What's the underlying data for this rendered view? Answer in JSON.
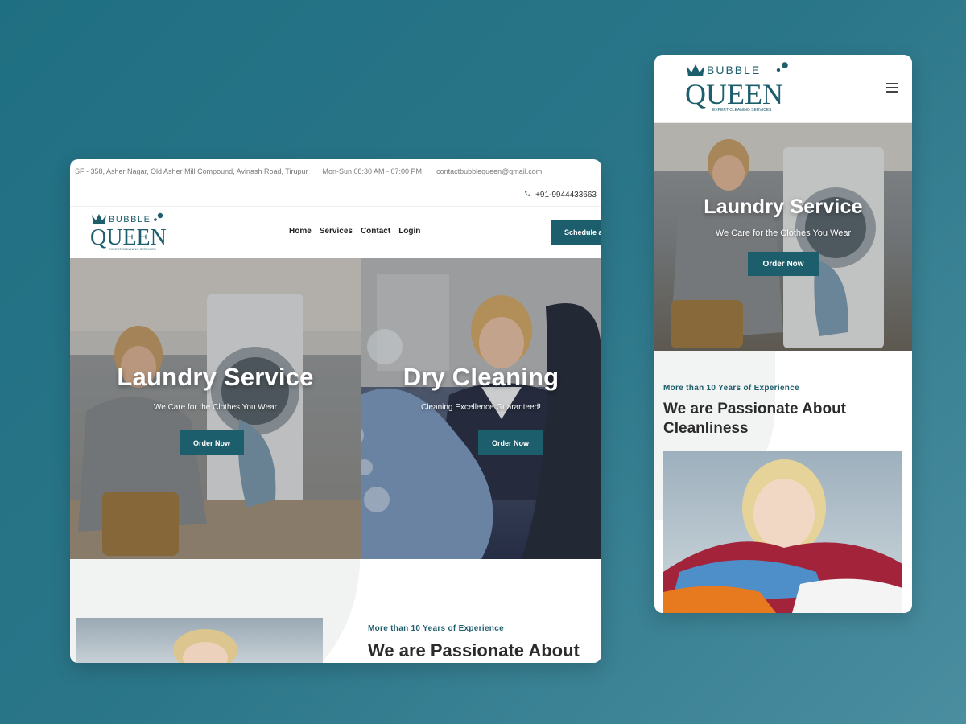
{
  "brand": {
    "logo_top": "BUBBLE",
    "logo_main": "QUEEN",
    "logo_tagline": "EXPERT CLEANING SERVICES",
    "accent": "#1d5e6d"
  },
  "desktop": {
    "topbar": {
      "address": "SF - 358, Asher Nagar, Old Asher Mill Compound, Avinash Road, Tirupur",
      "hours": "Mon-Sun 08:30 AM - 07:00 PM",
      "email": "contactbubblequeen@gmail.com",
      "phone": "+91-9944433663",
      "phone_icon": "phone-icon"
    },
    "nav": {
      "items": [
        {
          "label": "Home"
        },
        {
          "label": "Services"
        },
        {
          "label": "Contact"
        },
        {
          "label": "Login"
        }
      ],
      "cta_label": "Schedule a"
    },
    "hero": {
      "slides": [
        {
          "title": "Laundry Service",
          "subtitle": "We Care for the Clothes You Wear",
          "button": "Order Now"
        },
        {
          "title": "Dry Cleaning",
          "subtitle": "Cleaning Excellence Guaranteed!",
          "button": "Order Now"
        }
      ]
    },
    "about": {
      "kicker": "More than 10 Years of Experience",
      "heading": "We are Passionate About"
    }
  },
  "mobile": {
    "menu_icon": "hamburger-icon",
    "hero": {
      "title": "Laundry Service",
      "subtitle": "We Care for the Clothes You Wear",
      "button": "Order Now"
    },
    "about": {
      "kicker": "More than 10 Years of Experience",
      "heading": "We are Passionate About Cleanliness"
    }
  }
}
